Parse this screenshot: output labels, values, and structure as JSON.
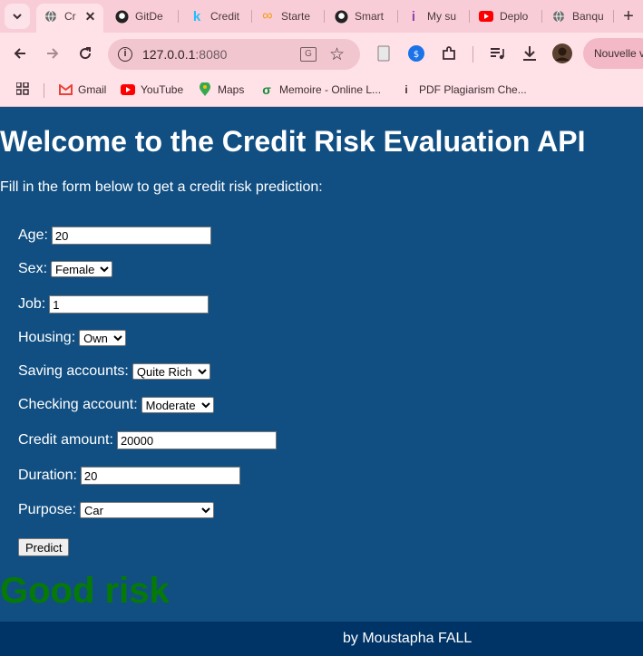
{
  "browser": {
    "tabs": [
      {
        "title": "Cr",
        "icon": "globe-icon",
        "active": true
      },
      {
        "title": "GitDe",
        "icon": "github-icon"
      },
      {
        "title": "Credit",
        "icon": "kaggle-icon"
      },
      {
        "title": "Starte",
        "icon": "infinity-icon"
      },
      {
        "title": "Smart",
        "icon": "github-icon"
      },
      {
        "title": "My su",
        "icon": "info-icon"
      },
      {
        "title": "Deplo",
        "icon": "youtube-icon"
      },
      {
        "title": "Banqu",
        "icon": "globe-icon"
      }
    ],
    "url_host": "127.0.0.1",
    "url_port": ":8080",
    "profile_button": "Nouvelle v",
    "bookmarks": [
      {
        "label": "Gmail",
        "icon": "gmail-icon"
      },
      {
        "label": "YouTube",
        "icon": "youtube-icon"
      },
      {
        "label": "Maps",
        "icon": "maps-icon"
      },
      {
        "label": "Memoire - Online L...",
        "icon": "overleaf-icon"
      },
      {
        "label": "PDF Plagiarism Che...",
        "icon": "info-icon"
      }
    ]
  },
  "page": {
    "title": "Welcome to the Credit Risk Evaluation API",
    "intro": "Fill in the form below to get a credit risk prediction:",
    "form": {
      "age": {
        "label": "Age:",
        "value": "20"
      },
      "sex": {
        "label": "Sex:",
        "value": "Female"
      },
      "job": {
        "label": "Job:",
        "value": "1"
      },
      "housing": {
        "label": "Housing:",
        "value": "Own"
      },
      "saving": {
        "label": "Saving accounts:",
        "value": "Quite Rich"
      },
      "checking": {
        "label": "Checking account:",
        "value": "Moderate"
      },
      "credit": {
        "label": "Credit amount:",
        "value": "20000"
      },
      "duration": {
        "label": "Duration:",
        "value": "20"
      },
      "purpose": {
        "label": "Purpose:",
        "value": "Car"
      },
      "submit": "Predict"
    },
    "result": "Good risk",
    "footer": "by Moustapha FALL"
  },
  "colors": {
    "page_bg": "#114f82",
    "footer_bg": "#003366",
    "result_green": "#067a06",
    "chrome_pink": "#ffe2e8"
  }
}
